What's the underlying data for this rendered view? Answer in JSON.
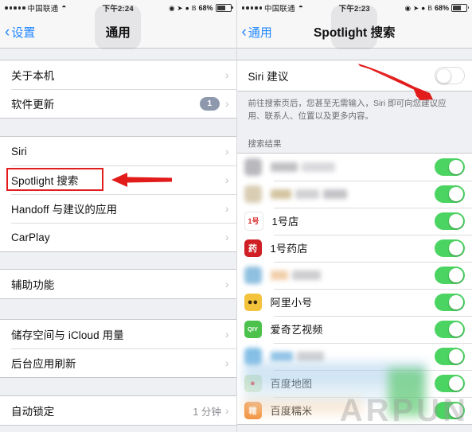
{
  "left": {
    "status": {
      "carrier": "中国联通",
      "signal_dots": 5,
      "wifi_icon": "wifi-icon",
      "time": "下午2:24",
      "icons": [
        "rotation-lock-icon",
        "location-arrow-icon",
        "alarm-icon",
        "bluetooth-icon"
      ],
      "battery_pct": "68%"
    },
    "nav": {
      "back_label": "设置",
      "title": "通用"
    },
    "groups": [
      {
        "rows": [
          {
            "label": "关于本机",
            "value": "",
            "badge": "",
            "chevron": true
          },
          {
            "label": "软件更新",
            "value": "",
            "badge": "1",
            "chevron": true
          }
        ]
      },
      {
        "rows": [
          {
            "label": "Siri",
            "value": "",
            "badge": "",
            "chevron": true
          },
          {
            "label": "Spotlight 搜索",
            "value": "",
            "badge": "",
            "chevron": true,
            "highlight": true
          },
          {
            "label": "Handoff 与建议的应用",
            "value": "",
            "badge": "",
            "chevron": true
          },
          {
            "label": "CarPlay",
            "value": "",
            "badge": "",
            "chevron": true
          }
        ]
      },
      {
        "rows": [
          {
            "label": "辅助功能",
            "value": "",
            "badge": "",
            "chevron": true
          }
        ]
      },
      {
        "rows": [
          {
            "label": "储存空间与 iCloud 用量",
            "value": "",
            "badge": "",
            "chevron": true
          },
          {
            "label": "后台应用刷新",
            "value": "",
            "badge": "",
            "chevron": true
          }
        ]
      },
      {
        "rows": [
          {
            "label": "自动锁定",
            "value": "1 分钟",
            "badge": "",
            "chevron": true
          }
        ]
      }
    ]
  },
  "right": {
    "status": {
      "carrier": "中国联通",
      "signal_dots": 5,
      "wifi_icon": "wifi-icon",
      "time": "下午2:23",
      "icons": [
        "rotation-lock-icon",
        "location-arrow-icon",
        "alarm-icon",
        "bluetooth-icon"
      ],
      "battery_pct": "68%"
    },
    "nav": {
      "back_label": "通用",
      "title": "Spotlight 搜索"
    },
    "siri_row": {
      "label": "Siri 建议",
      "toggle": "off"
    },
    "footnote": "前往搜索页后，您甚至无需输入，Siri 即可向您建议应用、联系人、位置以及更多内容。",
    "section_header": "搜索结果",
    "apps": [
      {
        "name": "",
        "censored": true,
        "icon_color": "#b9b9bd",
        "icon_text": "",
        "toggle": "on"
      },
      {
        "name": "",
        "censored": true,
        "icon_color": "#d9cdb4",
        "icon_text": "",
        "toggle": "on"
      },
      {
        "name": "1号店",
        "censored": false,
        "icon_color": "#ffffff",
        "icon_text": "1号",
        "icon_fg": "#d8252a",
        "toggle": "on"
      },
      {
        "name": "1号药店",
        "censored": false,
        "icon_color": "#cf1f24",
        "icon_text": "药",
        "icon_fg": "#ffffff",
        "toggle": "on"
      },
      {
        "name": "",
        "censored": true,
        "icon_color": "#8fc0e0",
        "icon_text": "",
        "toggle": "on"
      },
      {
        "name": "阿里小号",
        "censored": false,
        "icon_color": "#f4c33c",
        "icon_text": "◠",
        "icon_fg": "#4a3217",
        "toggle": "on"
      },
      {
        "name": "爱奇艺视频",
        "censored": false,
        "icon_color": "#4cc24c",
        "icon_text": "QIY",
        "icon_fg": "#ffffff",
        "toggle": "on"
      },
      {
        "name": "",
        "censored": true,
        "icon_color": "#84bfe6",
        "icon_text": "",
        "toggle": "on"
      },
      {
        "name": "百度地图",
        "censored": false,
        "icon_color": "#d9ecc4",
        "icon_text": "◉",
        "icon_fg": "#e8322c",
        "toggle": "on"
      },
      {
        "name": "百度糯米",
        "censored": false,
        "icon_color": "#f2903a",
        "icon_text": "糯",
        "icon_fg": "#ffffff",
        "toggle": "on"
      }
    ],
    "watermark": "ARPUN"
  },
  "colors": {
    "accent_blue": "#1f86ff",
    "toggle_green": "#4cd462",
    "annotation_red": "#e21b1b",
    "group_bg": "#eff0f3"
  }
}
